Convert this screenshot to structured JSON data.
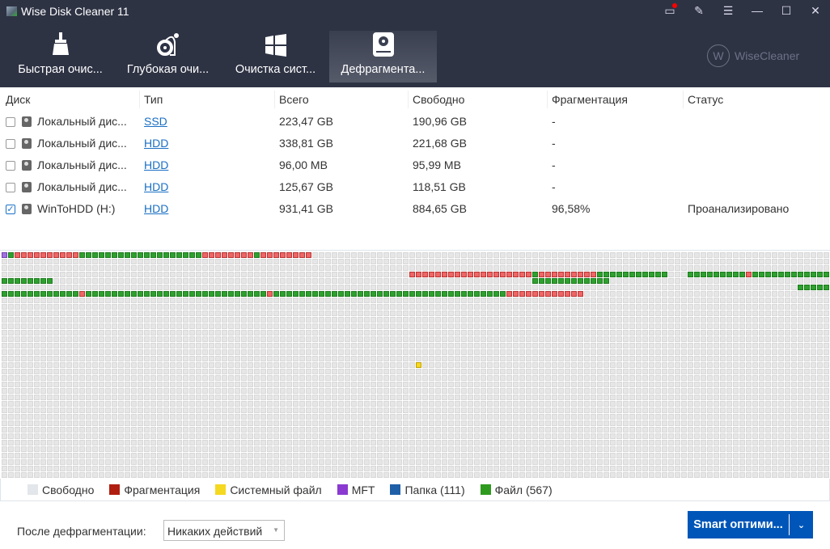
{
  "window": {
    "title": "Wise Disk Cleaner 11"
  },
  "brand": {
    "logo_letter": "W",
    "name": "WiseCleaner"
  },
  "tabs": [
    {
      "label": "Быстрая очис...",
      "icon": "broom-icon"
    },
    {
      "label": "Глубокая очи...",
      "icon": "vacuum-icon"
    },
    {
      "label": "Очистка сист...",
      "icon": "windows-icon"
    },
    {
      "label": "Дефрагмента...",
      "icon": "disk-icon",
      "active": true
    }
  ],
  "table": {
    "headers": [
      "Диск",
      "Тип",
      "Всего",
      "Свободно",
      "Фрагментация",
      "Статус"
    ],
    "rows": [
      {
        "checked": false,
        "disk": "Локальный дис...",
        "type": "SSD",
        "total": "223,47 GB",
        "free": "190,96 GB",
        "frag": "-",
        "status": ""
      },
      {
        "checked": false,
        "disk": "Локальный дис...",
        "type": "HDD",
        "total": "338,81 GB",
        "free": "221,68 GB",
        "frag": "-",
        "status": ""
      },
      {
        "checked": false,
        "disk": "Локальный дис...",
        "type": "HDD",
        "total": "96,00 MB",
        "free": "95,99 MB",
        "frag": "-",
        "status": ""
      },
      {
        "checked": false,
        "disk": "Локальный дис...",
        "type": "HDD",
        "total": "125,67 GB",
        "free": "118,51 GB",
        "frag": "-",
        "status": ""
      },
      {
        "checked": true,
        "disk": "WinToHDD (H:)",
        "type": "HDD",
        "total": "931,41 GB",
        "free": "884,65 GB",
        "frag": "96,58%",
        "status": "Проанализировано"
      }
    ]
  },
  "cluster_map": {
    "rows": 35,
    "cols": 128,
    "segments": [
      [
        0,
        0,
        1,
        "p"
      ],
      [
        0,
        1,
        1,
        "g"
      ],
      [
        0,
        2,
        10,
        "r"
      ],
      [
        0,
        12,
        19,
        "g"
      ],
      [
        0,
        31,
        8,
        "r"
      ],
      [
        0,
        39,
        1,
        "g"
      ],
      [
        0,
        40,
        8,
        "r"
      ],
      [
        3,
        63,
        19,
        "r"
      ],
      [
        3,
        82,
        1,
        "g"
      ],
      [
        3,
        83,
        9,
        "r"
      ],
      [
        3,
        92,
        11,
        "g"
      ],
      [
        3,
        106,
        9,
        "g"
      ],
      [
        3,
        115,
        1,
        "r"
      ],
      [
        3,
        116,
        12,
        "g"
      ],
      [
        4,
        0,
        8,
        "g"
      ],
      [
        4,
        82,
        12,
        "g"
      ],
      [
        5,
        123,
        5,
        "g"
      ],
      [
        6,
        0,
        12,
        "g"
      ],
      [
        6,
        12,
        1,
        "r"
      ],
      [
        6,
        13,
        28,
        "g"
      ],
      [
        6,
        41,
        1,
        "r"
      ],
      [
        6,
        42,
        36,
        "g"
      ],
      [
        6,
        78,
        12,
        "r"
      ],
      [
        17,
        64,
        1,
        "y"
      ]
    ]
  },
  "legend": [
    {
      "label": "Свободно",
      "color": "#e3e6ea"
    },
    {
      "label": "Фрагментация",
      "color": "#b01e10"
    },
    {
      "label": "Системный файл",
      "color": "#f5d820"
    },
    {
      "label": "MFT",
      "color": "#8a3ad0"
    },
    {
      "label": "Папка (111)",
      "color": "#1f5fa8"
    },
    {
      "label": "Файл (567)",
      "color": "#2e9a1e"
    }
  ],
  "footer": {
    "after_label": "После дефрагментации:",
    "after_value": "Никаких действий",
    "smart_label": "Smart оптими..."
  }
}
